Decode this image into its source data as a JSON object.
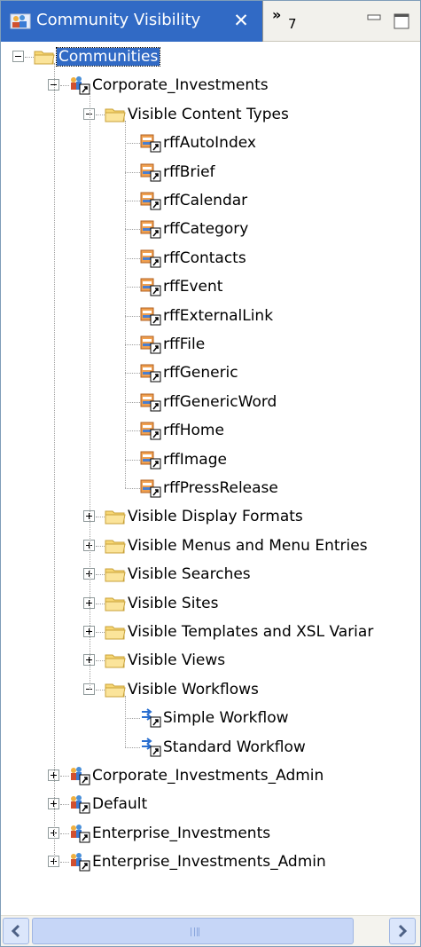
{
  "view": {
    "title": "Community Visibility",
    "close_glyph": "✕",
    "overflow_chevron": "»",
    "overflow_count": "7",
    "minimize_icon": "minimize-icon",
    "maximize_icon": "maximize-icon"
  },
  "tree": {
    "root": {
      "label": "Communities",
      "expanded": true,
      "selected": true
    },
    "communities": [
      {
        "label": "Corporate_Investments",
        "expanded": true,
        "folders": [
          {
            "label": "Visible Content Types",
            "expanded": true,
            "items": [
              "rffAutoIndex",
              "rffBrief",
              "rffCalendar",
              "rffCategory",
              "rffContacts",
              "rffEvent",
              "rffExternalLink",
              "rffFile",
              "rffGeneric",
              "rffGenericWord",
              "rffHome",
              "rffImage",
              "rffPressRelease"
            ]
          },
          {
            "label": "Visible Display Formats",
            "expanded": false
          },
          {
            "label": "Visible Menus and Menu Entries",
            "expanded": false
          },
          {
            "label": "Visible Searches",
            "expanded": false
          },
          {
            "label": "Visible Sites",
            "expanded": false
          },
          {
            "label": "Visible Templates and XSL Variar",
            "expanded": false
          },
          {
            "label": "Visible Views",
            "expanded": false
          },
          {
            "label": "Visible Workflows",
            "expanded": true,
            "workflows": [
              "Simple Workflow",
              "Standard Workflow"
            ]
          }
        ]
      },
      {
        "label": "Corporate_Investments_Admin",
        "expanded": false
      },
      {
        "label": "Default",
        "expanded": false
      },
      {
        "label": "Enterprise_Investments",
        "expanded": false
      },
      {
        "label": "Enterprise_Investments_Admin",
        "expanded": false
      }
    ]
  },
  "scrollbar": {
    "left_icon": "arrow-left-icon",
    "right_icon": "arrow-right-icon"
  },
  "colors": {
    "selection": "#316ac5",
    "folder": "#f7d774",
    "tab_active": "#316ac5"
  }
}
